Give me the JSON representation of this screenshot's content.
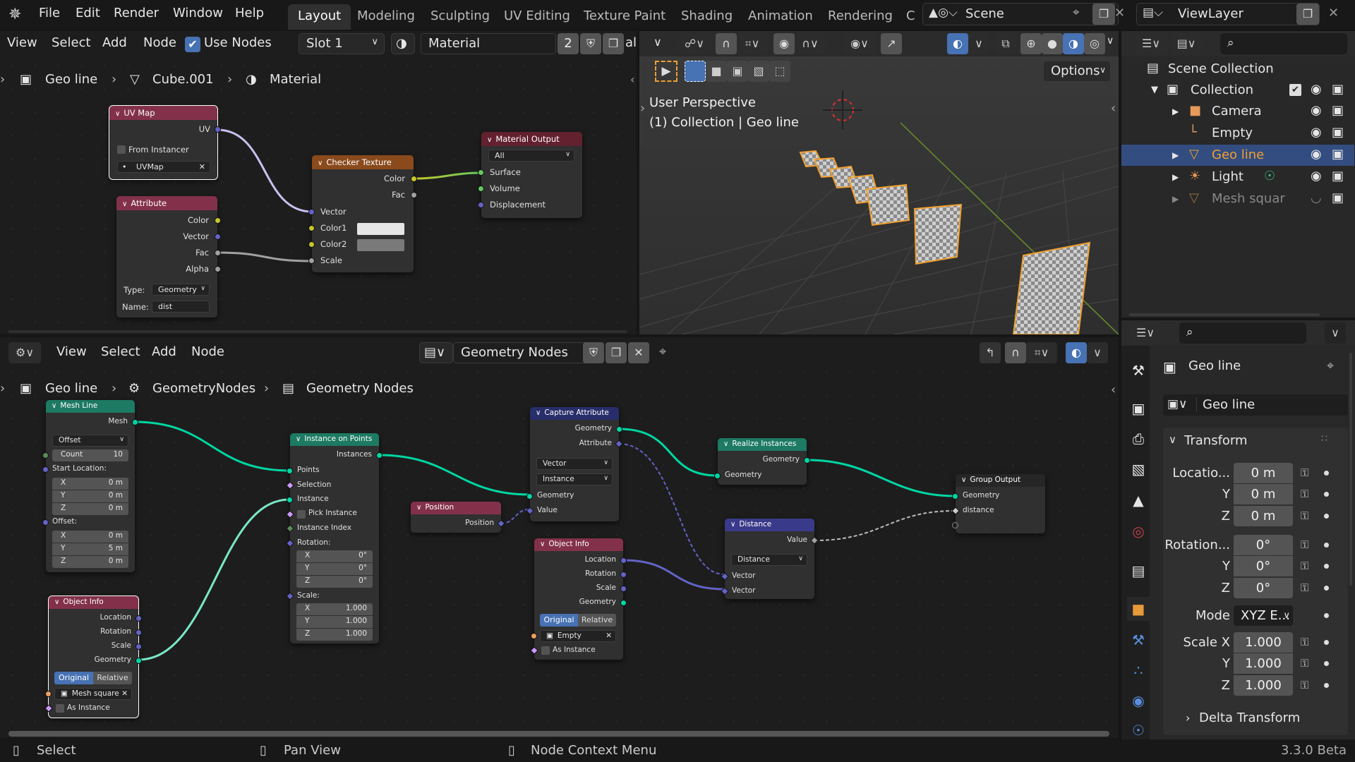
{
  "topbar": {
    "menus": [
      "File",
      "Edit",
      "Render",
      "Window",
      "Help"
    ],
    "workspaces": [
      "Layout",
      "Modeling",
      "Sculpting",
      "UV Editing",
      "Texture Paint",
      "Shading",
      "Animation",
      "Rendering",
      "C"
    ],
    "active_workspace": "Layout",
    "scene": "Scene",
    "view_layer": "ViewLayer"
  },
  "shader_editor": {
    "menus": [
      "View",
      "Select",
      "Add",
      "Node"
    ],
    "use_nodes_label": "Use Nodes",
    "use_nodes_checked": true,
    "slot": "Slot 1",
    "material_name": "Material",
    "users": "2",
    "truncated": "al",
    "breadcrumb": [
      "Geo line",
      "Cube.001",
      "Material"
    ],
    "nodes": {
      "uv_map": {
        "title": "UV Map",
        "out_uv": "UV",
        "from_instancer": "From Instancer",
        "uvmap": "UVMap"
      },
      "attribute": {
        "title": "Attribute",
        "outputs": [
          "Color",
          "Vector",
          "Fac",
          "Alpha"
        ],
        "type_label": "Type:",
        "type_value": "Geometry",
        "name_label": "Name:",
        "name_value": "dist"
      },
      "checker": {
        "title": "Checker Texture",
        "outputs": [
          "Color",
          "Fac"
        ],
        "inputs": [
          "Vector",
          "Color1",
          "Color2",
          "Scale"
        ]
      },
      "material_output": {
        "title": "Material Output",
        "target": "All",
        "inputs": [
          "Surface",
          "Volume",
          "Displacement"
        ]
      }
    }
  },
  "viewport": {
    "title": "User Perspective",
    "subtitle": "(1) Collection | Geo line",
    "options_label": "Options"
  },
  "outliner": {
    "root": "Scene Collection",
    "items": [
      {
        "label": "Collection",
        "icon": "collection-icon",
        "checked": true
      },
      {
        "label": "Camera",
        "icon": "camera-icon"
      },
      {
        "label": "Empty",
        "icon": "empty-icon"
      },
      {
        "label": "Geo line",
        "icon": "mesh-icon",
        "selected": true
      },
      {
        "label": "Light",
        "icon": "light-icon"
      },
      {
        "label": "Mesh squar",
        "icon": "mesh-icon",
        "hidden": true
      }
    ]
  },
  "geo_editor": {
    "menus": [
      "View",
      "Select",
      "Add",
      "Node"
    ],
    "tree_name": "Geometry Nodes",
    "breadcrumb": [
      "Geo line",
      "GeometryNodes",
      "Geometry Nodes"
    ],
    "nodes": {
      "mesh_line": {
        "title": "Mesh Line",
        "out": "Mesh",
        "mode": "Offset",
        "count_label": "Count",
        "count": "10",
        "start_label": "Start Location:",
        "start": [
          "0 m",
          "0 m",
          "0 m"
        ],
        "offset_label": "Offset:",
        "offset": [
          "0 m",
          "5 m",
          "0 m"
        ],
        "axes": [
          "X",
          "Y",
          "Z"
        ]
      },
      "object_info_1": {
        "title": "Object Info",
        "outputs": [
          "Location",
          "Rotation",
          "Scale",
          "Geometry"
        ],
        "seg": [
          "Original",
          "Relative"
        ],
        "object": "Mesh square",
        "as_instance": "As Instance"
      },
      "instance_on_points": {
        "title": "Instance on Points",
        "out": "Instances",
        "inputs": [
          "Points",
          "Selection",
          "Instance",
          "Pick Instance",
          "Instance Index",
          "Rotation:"
        ],
        "rotation": [
          "0°",
          "0°",
          "0°"
        ],
        "scale_label": "Scale:",
        "scale": [
          "1.000",
          "1.000",
          "1.000"
        ],
        "axes": [
          "X",
          "Y",
          "Z"
        ]
      },
      "position": {
        "title": "Position",
        "out": "Position"
      },
      "capture_attribute": {
        "title": "Capture Attribute",
        "outputs": [
          "Geometry",
          "Attribute"
        ],
        "type": "Vector",
        "domain": "Instance",
        "inputs": [
          "Geometry",
          "Value"
        ]
      },
      "object_info_2": {
        "title": "Object Info",
        "outputs": [
          "Location",
          "Rotation",
          "Scale",
          "Geometry"
        ],
        "seg": [
          "Original",
          "Relative"
        ],
        "object": "Empty",
        "as_instance": "As Instance"
      },
      "realize_instances": {
        "title": "Realize Instances",
        "out": "Geometry",
        "in": "Geometry"
      },
      "distance": {
        "title": "Distance",
        "out": "Value",
        "op": "Distance",
        "inputs": [
          "Vector",
          "Vector"
        ]
      },
      "group_output": {
        "title": "Group Output",
        "inputs": [
          "Geometry",
          "distance"
        ]
      }
    }
  },
  "properties": {
    "object_name": "Geo line",
    "data_name": "Geo line",
    "panel": "Transform",
    "location_label": "Locatio...",
    "location": [
      "0 m",
      "0 m",
      "0 m"
    ],
    "rotation_label": "Rotation...",
    "rotation": [
      "0°",
      "0°",
      "0°"
    ],
    "mode_label": "Mode",
    "mode": "XYZ E...",
    "scale_label": "Scale X",
    "scale": [
      "1.000",
      "1.000",
      "1.000"
    ],
    "axis_y": "Y",
    "axis_z": "Z",
    "delta": "Delta Transform"
  },
  "statusbar": {
    "select": "Select",
    "pan": "Pan View",
    "context": "Node Context Menu",
    "version": "3.3.0 Beta"
  }
}
